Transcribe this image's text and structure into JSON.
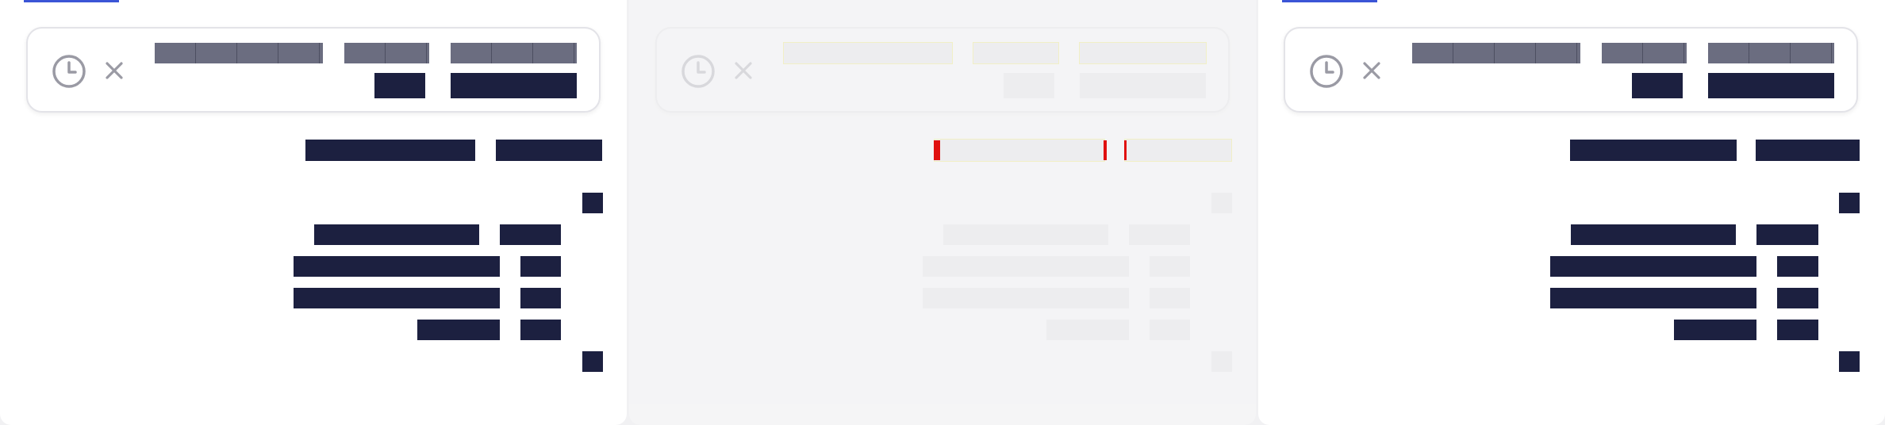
{
  "screen": {
    "background": "#f1f1f3",
    "panels": [
      {
        "state": "loaded",
        "tab_indicator_color": "#3b55d6"
      },
      {
        "state": "placeholder"
      },
      {
        "state": "loaded",
        "tab_indicator_color": "#3b55d6"
      }
    ]
  },
  "card": {
    "icons": [
      "clock-icon",
      "close-icon"
    ],
    "header_lines": [
      "",
      "",
      "",
      "",
      ""
    ]
  },
  "content": {
    "rows": [
      "",
      "",
      "",
      "",
      "",
      "",
      "",
      "",
      ""
    ]
  },
  "colors": {
    "redacted_text_dark": "#1c2040",
    "redacted_text_muted": "#6b6d80",
    "placeholder": "#e6e6e6",
    "highlight_outline": "#f1ea55",
    "error_mark": "#e01010",
    "icon_gray": "#9a9aa4"
  }
}
